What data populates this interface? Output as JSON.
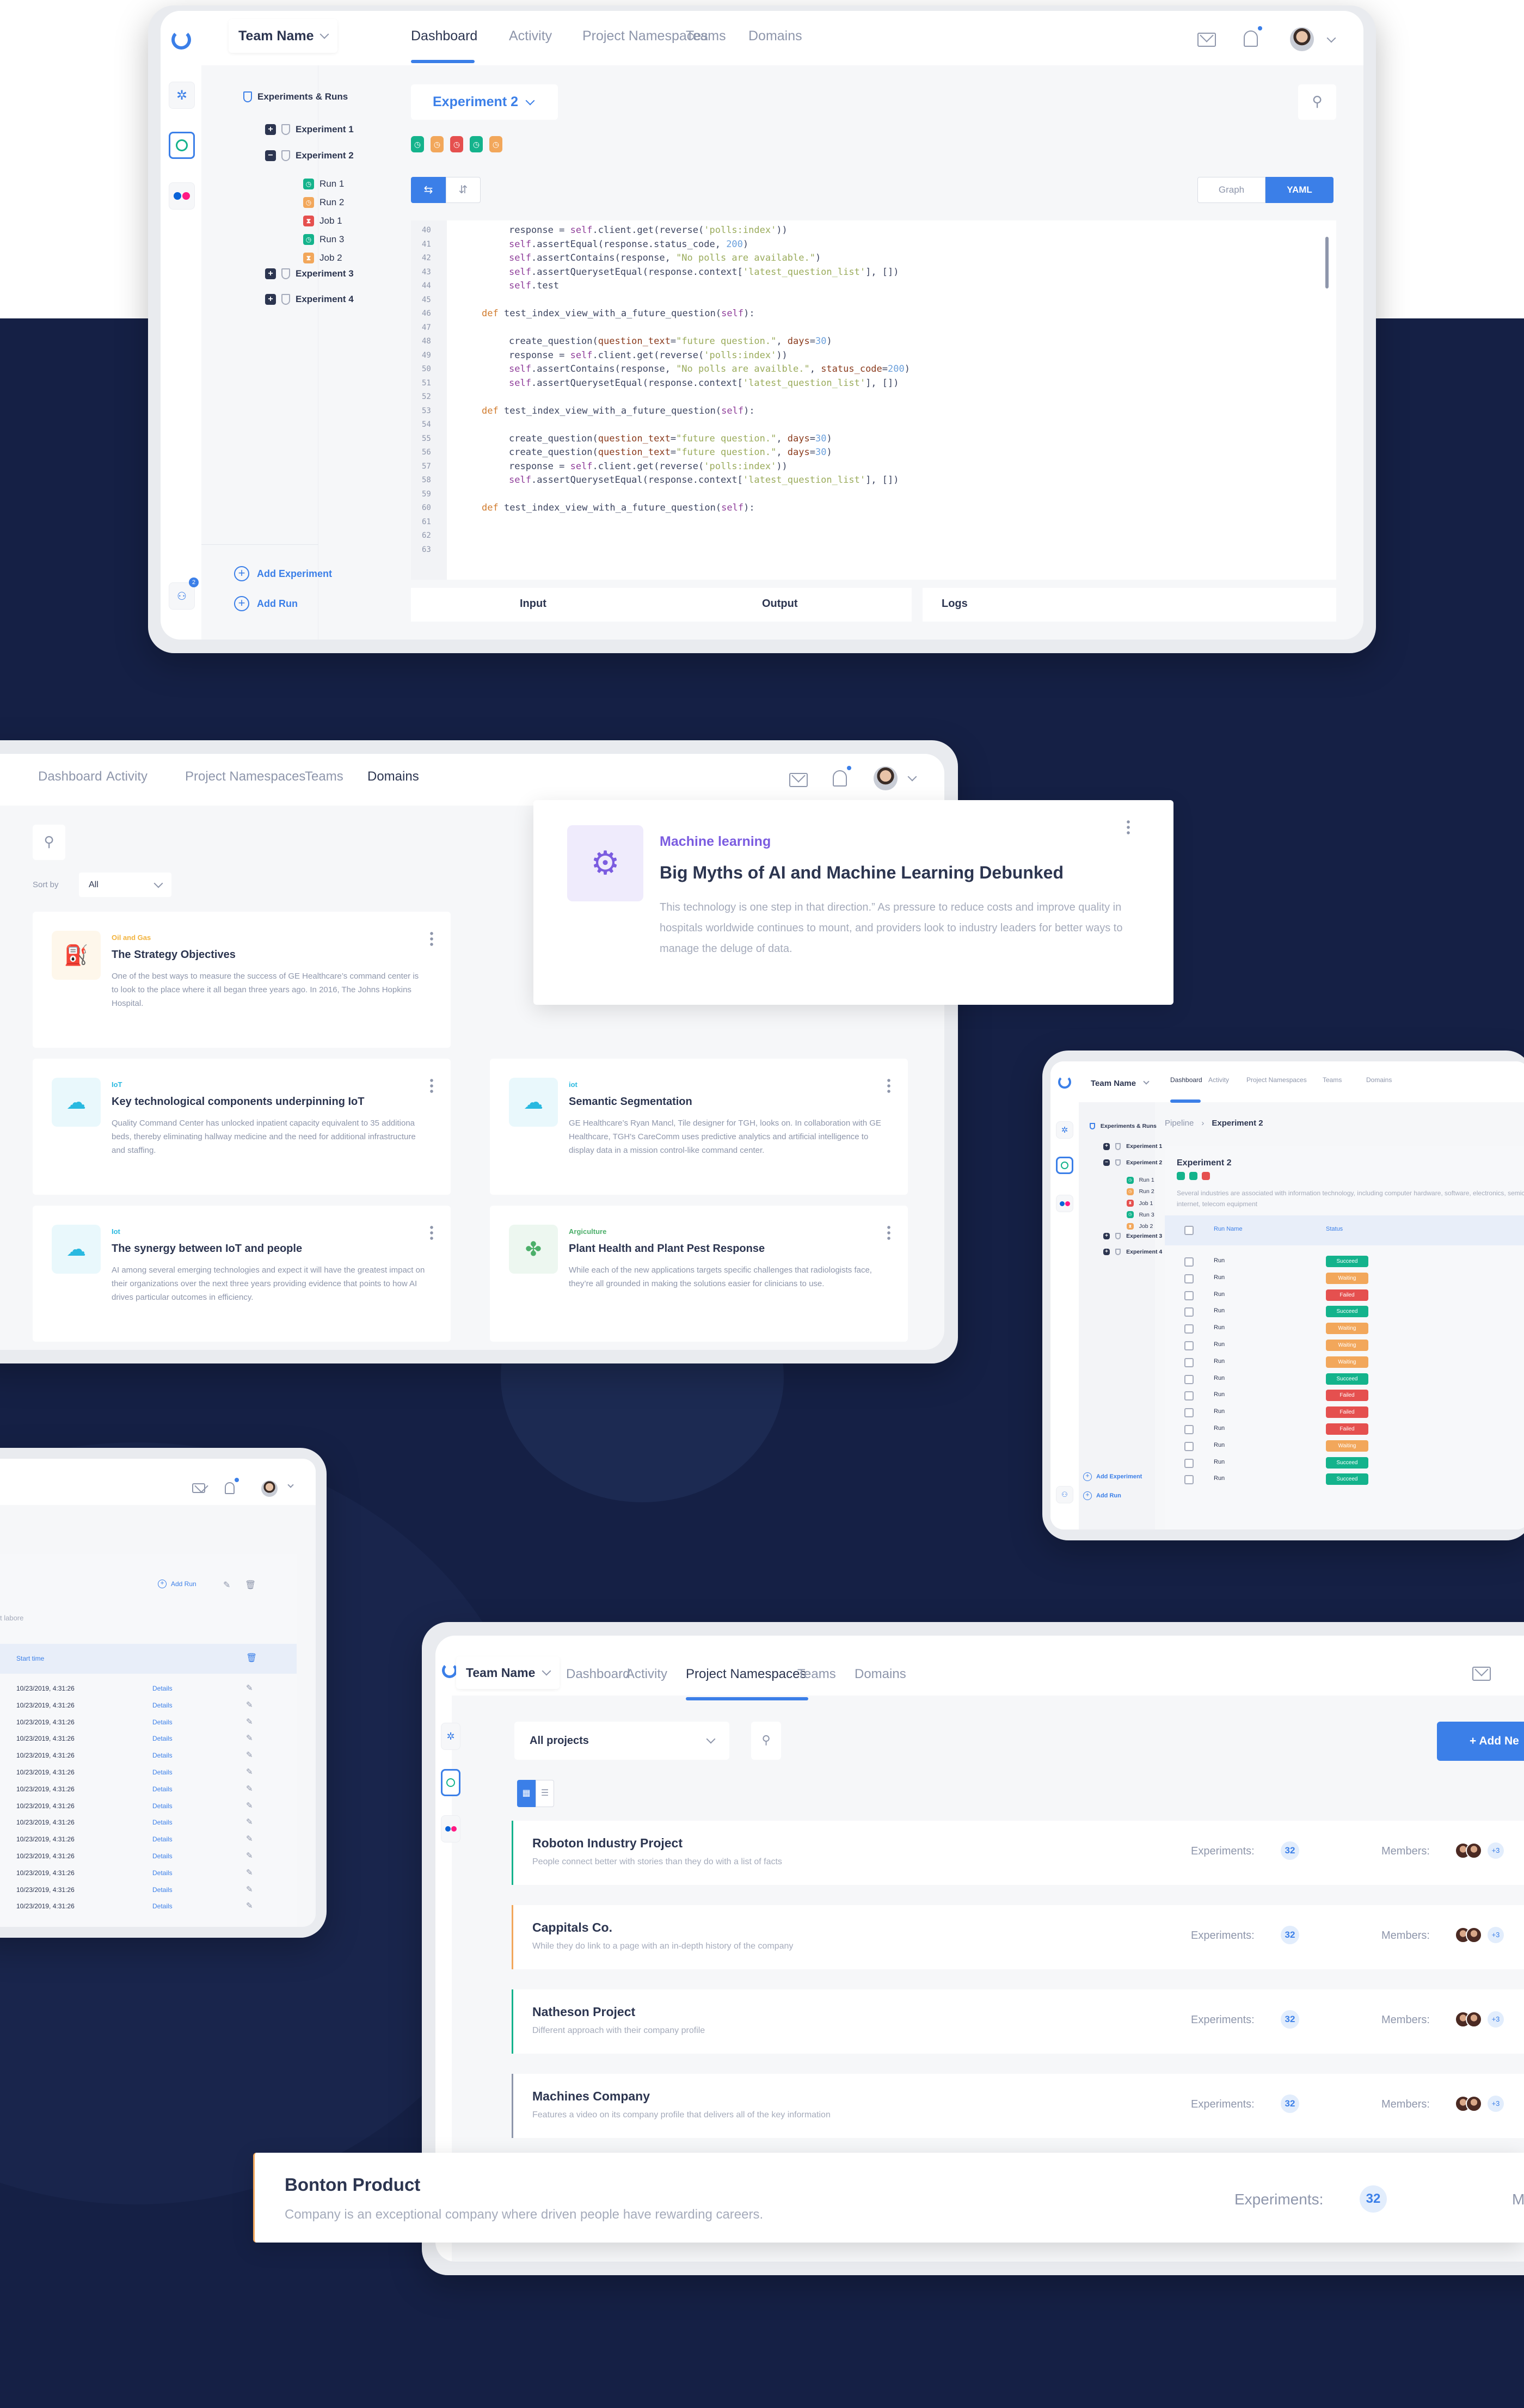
{
  "nav": {
    "team_name": "Team Name",
    "tabs": [
      "Dashboard",
      "Activity",
      "Project Namespaces",
      "Teams",
      "Domains"
    ]
  },
  "panel1": {
    "active_tab": "Dashboard",
    "tree_title": "Experiments & Runs",
    "experiments": [
      {
        "label": "Experiment 1",
        "expanded": false
      },
      {
        "label": "Experiment 2",
        "expanded": true
      },
      {
        "label": "Experiment 3",
        "expanded": false
      },
      {
        "label": "Experiment 4",
        "expanded": false
      }
    ],
    "runs": [
      {
        "label": "Run 1",
        "status": "green",
        "icon": "stopwatch-icon"
      },
      {
        "label": "Run 2",
        "status": "orange",
        "icon": "stopwatch-icon"
      },
      {
        "label": "Job 1",
        "status": "red",
        "icon": "hourglass-icon"
      },
      {
        "label": "Run 3",
        "status": "green",
        "icon": "stopwatch-icon"
      },
      {
        "label": "Job 2",
        "status": "orange",
        "icon": "hourglass-icon"
      }
    ],
    "add_experiment": "Add Experiment",
    "add_run": "Add Run",
    "rail_badge": "2",
    "experiment_select": "Experiment 2",
    "status_chips": [
      "green",
      "orange",
      "red",
      "green",
      "orange"
    ],
    "view_toggle": {
      "graph": "Graph",
      "yaml": "YAML",
      "active": "YAML"
    },
    "code_lines": [
      {
        "n": "40",
        "indent": 1,
        "html": "response = <span class='p'>self</span>.client.get(reverse(<span class='s'>'polls:index'</span>))"
      },
      {
        "n": "41",
        "indent": 1,
        "html": "<span class='p'>self</span>.assertEqual(response.status_code, <span class='n'>200</span>)"
      },
      {
        "n": "42",
        "indent": 1,
        "html": "<span class='p'>self</span>.assertContains(response, <span class='s'>\"No polls are available.\"</span>)"
      },
      {
        "n": "43",
        "indent": 1,
        "html": "<span class='p'>self</span>.assertQuerysetEqual(response.context[<span class='s'>'latest_question_list'</span>], [])"
      },
      {
        "n": "44",
        "indent": 1,
        "html": "<span class='p'>self</span>.test"
      },
      {
        "n": "45",
        "indent": 0,
        "html": ""
      },
      {
        "n": "46",
        "indent": 0,
        "html": "<span class='k'>def</span> test_index_view_with_a_future_question(<span class='p'>self</span>):"
      },
      {
        "n": "47",
        "indent": 0,
        "html": ""
      },
      {
        "n": "48",
        "indent": 1,
        "html": "create_question(<span class='a'>question_text</span>=<span class='s'>\"future question.\"</span>, <span class='a'>days</span>=<span class='n'>30</span>)"
      },
      {
        "n": "49",
        "indent": 1,
        "html": "response = <span class='p'>self</span>.client.get(reverse(<span class='s'>'polls:index'</span>))"
      },
      {
        "n": "50",
        "indent": 1,
        "html": "<span class='p'>self</span>.assertContains(response, <span class='s'>\"No polls are availble.\"</span>, <span class='a'>status_code</span>=<span class='n'>200</span>)"
      },
      {
        "n": "51",
        "indent": 1,
        "html": "<span class='p'>self</span>.assertQuerysetEqual(response.context[<span class='s'>'latest_question_list'</span>], [])"
      },
      {
        "n": "52",
        "indent": 0,
        "html": ""
      },
      {
        "n": "53",
        "indent": 0,
        "html": "<span class='k'>def</span> test_index_view_with_a_future_question(<span class='p'>self</span>):"
      },
      {
        "n": "54",
        "indent": 0,
        "html": ""
      },
      {
        "n": "55",
        "indent": 1,
        "html": "create_question(<span class='a'>question_text</span>=<span class='s'>\"future question.\"</span>, <span class='a'>days</span>=<span class='n'>30</span>)"
      },
      {
        "n": "56",
        "indent": 1,
        "html": "create_question(<span class='a'>question_text</span>=<span class='s'>\"future question.\"</span>, <span class='a'>days</span>=<span class='n'>30</span>)"
      },
      {
        "n": "57",
        "indent": 1,
        "html": "response = <span class='p'>self</span>.client.get(reverse(<span class='s'>'polls:index'</span>))"
      },
      {
        "n": "58",
        "indent": 1,
        "html": "<span class='p'>self</span>.assertQuerysetEqual(response.context[<span class='s'>'latest_question_list'</span>], [])"
      },
      {
        "n": "59",
        "indent": 0,
        "html": ""
      },
      {
        "n": "60",
        "indent": 0,
        "html": "<span class='k'>def</span> test_index_view_with_a_future_question(<span class='p'>self</span>):"
      },
      {
        "n": "61",
        "indent": 0,
        "html": ""
      },
      {
        "n": "62",
        "indent": 0,
        "html": ""
      },
      {
        "n": "63",
        "indent": 0,
        "html": ""
      }
    ],
    "bottom_tabs": {
      "input": "Input",
      "output": "Output",
      "logs": "Logs"
    }
  },
  "panel2": {
    "active_tab": "Domains",
    "sort_label": "Sort by",
    "sort_value": "All",
    "featured": {
      "category": "Machine learning",
      "title": "Big Myths of AI and Machine Learning Debunked",
      "body": "This technology is one step in that direction.” As pressure to reduce costs and improve quality in hospitals worldwide continues to mount, and providers look to industry leaders for better ways to manage the deluge of data.",
      "accent": "#7b5ce0"
    },
    "cards": [
      {
        "category": "Oil and Gas",
        "title": "The Strategy Objectives",
        "body": "One of the best ways to measure the success of GE Healthcare’s command center is to look to the place where it all began three years ago. In 2016, The Johns Hopkins Hospital.",
        "accent": "#f2b33d",
        "icon": "oil-can-icon"
      },
      {
        "category": "IoT",
        "title": "Key technological components underpinning IoT",
        "body": "Quality Command Center has unlocked inpatient capacity equivalent to 35 additiona beds, thereby eliminating hallway medicine and the need for additional infrastructure and staffing.",
        "accent": "#29b9e0",
        "icon": "cloud-network-icon"
      },
      {
        "category": "iot",
        "title": "Semantic Segmentation",
        "body": "GE Healthcare’s Ryan Mancl, Tile designer for TGH, looks on. In collaboration with GE Healthcare, TGH's CareComm uses predictive analytics and artificial intelligence to display data in a mission control-like command center.",
        "accent": "#29b9e0",
        "icon": "cloud-network-icon"
      },
      {
        "category": "Iot",
        "title": "The synergy between IoT and people",
        "body": "AI among several emerging technologies and expect it will have the greatest impact on their organizations over the next three years providing evidence that points to how AI drives particular outcomes in efficiency.",
        "accent": "#29b9e0",
        "icon": "cloud-network-icon"
      },
      {
        "category": "Argiculture",
        "title": "Plant Health and Plant Pest Response",
        "body": "While each of the new applications targets specific challenges that radiologists face, they’re all grounded in making the solutions easier for clinicians to use.",
        "accent": "#4caf6a",
        "icon": "drone-plant-icon"
      }
    ]
  },
  "panel3": {
    "active_tab": "Dashboard",
    "breadcrumb": [
      "Pipeline",
      "Experiment 2"
    ],
    "title": "Experiment 2",
    "status_dots": [
      "green",
      "green",
      "red"
    ],
    "description": "Several industries are associated with information technology, including computer hardware, software, electronics, semiconductors, internet, telecom equipment",
    "columns": [
      "Run Name",
      "Status"
    ],
    "rows": [
      {
        "name": "Run",
        "status": "Succeed"
      },
      {
        "name": "Run",
        "status": "Waiting"
      },
      {
        "name": "Run",
        "status": "Failed"
      },
      {
        "name": "Run",
        "status": "Succeed"
      },
      {
        "name": "Run",
        "status": "Waiting"
      },
      {
        "name": "Run",
        "status": "Waiting"
      },
      {
        "name": "Run",
        "status": "Waiting"
      },
      {
        "name": "Run",
        "status": "Succeed"
      },
      {
        "name": "Run",
        "status": "Failed"
      },
      {
        "name": "Run",
        "status": "Failed"
      },
      {
        "name": "Run",
        "status": "Failed"
      },
      {
        "name": "Run",
        "status": "Waiting"
      },
      {
        "name": "Run",
        "status": "Succeed"
      },
      {
        "name": "Run",
        "status": "Succeed"
      }
    ],
    "status_colors": {
      "Succeed": "#14b38c",
      "Waiting": "#f2a75b",
      "Failed": "#e5504f"
    }
  },
  "panel4": {
    "add_run": "Add Run",
    "desc_fragment": "t labore",
    "column": "Start time",
    "rows": [
      "10/23/2019, 4:31:26",
      "10/23/2019, 4:31:26",
      "10/23/2019, 4:31:26",
      "10/23/2019, 4:31:26",
      "10/23/2019, 4:31:26",
      "10/23/2019, 4:31:26",
      "10/23/2019, 4:31:26",
      "10/23/2019, 4:31:26",
      "10/23/2019, 4:31:26",
      "10/23/2019, 4:31:26",
      "10/23/2019, 4:31:26",
      "10/23/2019, 4:31:26",
      "10/23/2019, 4:31:26",
      "10/23/2019, 4:31:26"
    ],
    "details_label": "Details"
  },
  "panel5": {
    "active_tab": "Project Namespaces",
    "filter_value": "All projects",
    "add_button": "+ Add Ne",
    "experiments_label": "Experiments:",
    "members_label": "Members:",
    "more_members": "+3",
    "projects": [
      {
        "title": "Roboton Industry Project",
        "desc": "People connect better with stories than they do with a list of facts",
        "experiments": "32",
        "accent": "#14b38c"
      },
      {
        "title": "Cappitals Co.",
        "desc": "While they do link to a page with an in-depth history of the company",
        "experiments": "32",
        "accent": "#f2a75b"
      },
      {
        "title": "Natheson Project",
        "desc": "Different approach with their company profile",
        "experiments": "32",
        "accent": "#14b38c"
      },
      {
        "title": "Machines Company",
        "desc": "Features a video on its company profile that delivers all of the key information",
        "experiments": "32",
        "accent": "#8e96ab"
      }
    ],
    "featured": {
      "title": "Bonton Product",
      "desc": "Company is an exceptional company where driven people have rewarding careers.",
      "experiments": "32",
      "members_fragment": "M",
      "accent": "#f2a75b"
    }
  }
}
